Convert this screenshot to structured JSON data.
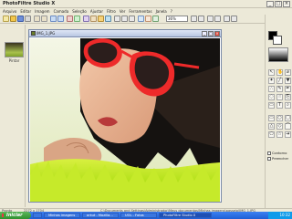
{
  "window": {
    "title": "PhotoFiltre Studio X",
    "buttons": {
      "minimize": "_",
      "maximize": "□",
      "close": "×"
    }
  },
  "menubar": {
    "items": [
      "Arquivo",
      "Editar",
      "Imagem",
      "Camada",
      "Seleção",
      "Ajustar",
      "Filtro",
      "Ver",
      "Ferramentas",
      "Janela",
      "?"
    ]
  },
  "toolbar": {
    "zoom": "36%"
  },
  "thumbnail": {
    "label": "Pintar"
  },
  "image_window": {
    "title": "IMG_1.JPG",
    "buttons": {
      "minimize": "_",
      "maximize": "□",
      "close": "×"
    }
  },
  "right_panel": {
    "check1": "Contorno",
    "check2": "Preencher"
  },
  "statusbar": {
    "left": "Pronto",
    "dims": "2272 x 1704",
    "path": "C:\\Documents and Settings\\Administrador\\Meus documentos\\Minhas imagens\\passeio\\IMG_1.JPG"
  },
  "taskbar": {
    "start": "Iniciar",
    "tasks": [
      "",
      "Minhas imagens",
      "orkut - Mozilla...",
      "UOL - Fotos",
      "PhotoFiltre Studio X"
    ],
    "clock": "10:32"
  },
  "colors": {
    "accent": "#1f5fd4",
    "sunglasses": "#ee2a2a",
    "grass": "#b6e21c"
  }
}
